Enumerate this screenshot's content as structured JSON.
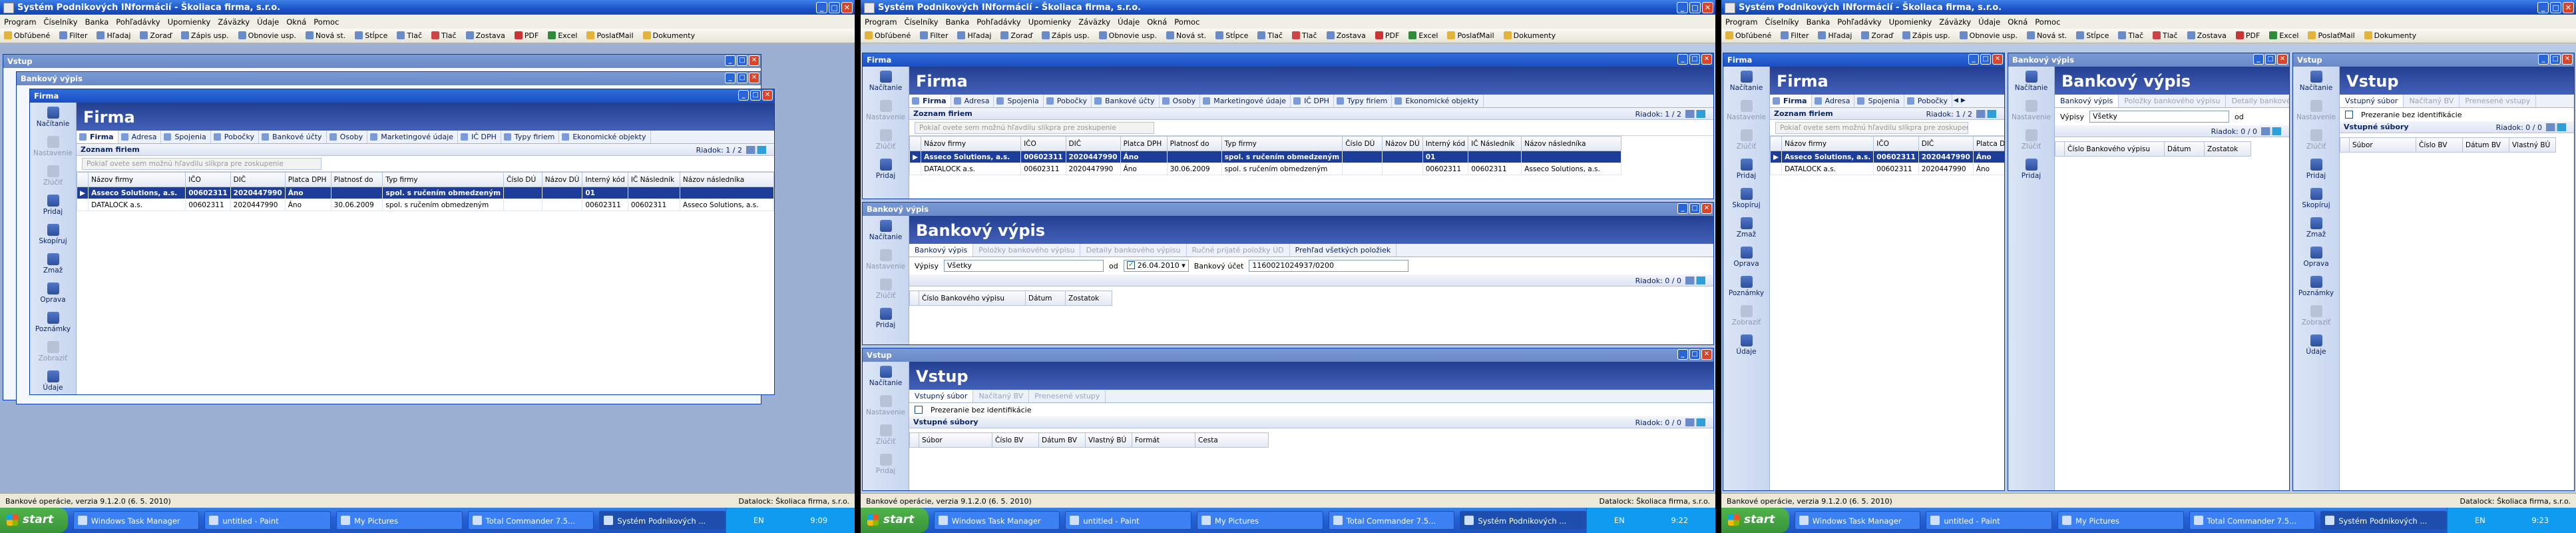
{
  "app": {
    "title": "Systém Podnikových INformácií - Školiaca firma, s.r.o.",
    "menu": [
      "Program",
      "Číselníky",
      "Banka",
      "Pohľadávky",
      "Upomienky",
      "Záväzky",
      "Údaje",
      "Okná",
      "Pomoc"
    ],
    "toolbar": [
      "Obľúbené",
      "Filter",
      "Hľadaj",
      "Zoraď",
      "Zápis usp.",
      "Obnovie usp.",
      "Nová st.",
      "Stĺpce",
      "Tlač",
      "Tlač",
      "Zostava",
      "PDF",
      "Excel",
      "PoslaťMail",
      "Dokumenty"
    ],
    "status_left": "Bankové operácie, verzia 9.1.2.0 (6. 5. 2010)",
    "status_right": "Datalock: Školiaca firma, s.r.o."
  },
  "taskbar": {
    "start": "start",
    "tasks": [
      "Windows Task Manager",
      "untitled - Paint",
      "My Pictures",
      "Total Commander 7.5...",
      "Systém Podnikových ..."
    ],
    "lang": "EN",
    "clock": [
      "9:09",
      "9:22",
      "9:23"
    ]
  },
  "firma": {
    "title": "Firma",
    "actions": [
      "Načítanie",
      "Nastavenie",
      "Zlúčiť",
      "Pridaj",
      "Skopíruj",
      "Zmaž",
      "Oprava",
      "Poznámky",
      "Zobraziť",
      "Údaje"
    ],
    "tabs": [
      "Firma",
      "Adresa",
      "Spojenia",
      "Pobočky",
      "Bankové účty",
      "Osoby",
      "Marketingové údaje",
      "IČ DPH",
      "Typy firiem",
      "Ekonomické objekty"
    ],
    "section": "Zoznam firiem",
    "records": "Riadok: 1 / 2",
    "filter_placeholder": "Pokiaľ ovete sem možnú hľavdilu slíkpra pre zoskupenie",
    "columns": [
      "Názov firmy",
      "IČO",
      "DIČ",
      "Platca DPH",
      "Platnosť do",
      "Typ firmy",
      "Číslo DÚ",
      "Názov DÚ",
      "Interný kód",
      "IČ Následník",
      "Názov následníka"
    ],
    "rows": [
      [
        "Asseco Solutions, a.s.",
        "00602311",
        "2020447990",
        "Áno",
        "",
        "spol. s ručením obmedzeným",
        "",
        "",
        "01",
        "",
        ""
      ],
      [
        "DATALOCK a.s.",
        "00602311",
        "2020447990",
        "Áno",
        "30.06.2009",
        "spol. s ručením obmedzeným",
        "",
        "",
        "00602311",
        "00602311",
        "Asseco Solutions, a.s."
      ]
    ]
  },
  "bank": {
    "title": "Bankový výpis",
    "actions": [
      "Načítanie",
      "Nastavenie",
      "Zlúčiť",
      "Pridaj"
    ],
    "tabs": [
      "Bankový výpis",
      "Položky bankového výpisu",
      "Detaily bankového výpisu",
      "Ručné prijaté položky ÚD",
      "Prehľad všetkých položiek"
    ],
    "vypisy_label": "Výpisy",
    "vypisy_value": "Všetky",
    "od_label": "od",
    "date": "26.04.2010",
    "account_label": "Bankový účet",
    "account": "1160021024937/0200",
    "records": "Riadok: 0 / 0",
    "columns": [
      "Číslo Bankového výpisu",
      "Dátum",
      "Zostatok"
    ]
  },
  "vstup": {
    "title": "Vstup",
    "actions": [
      "Načítanie",
      "Nastavenie",
      "Zlúčiť",
      "Pridaj",
      "Skopíruj",
      "Zmaž",
      "Oprava",
      "Poznámky",
      "Zobraziť",
      "Údaje"
    ],
    "tabs": [
      "Vstupný súbor",
      "Načítaný BV",
      "Prenesené vstupy"
    ],
    "checkbox": "Prezeranie bez identifikácie",
    "section": "Vstupné súbory",
    "records": "Riadok: 0 / 0",
    "columns": [
      "Súbor",
      "Číslo BV",
      "Dátum BV",
      "Vlastný BÚ",
      "Formát",
      "Cesta"
    ]
  },
  "colors": {
    "titlebar": "#1a54c8",
    "header": "#223f91",
    "selection": "#1c3d9a",
    "start": "#3a9438"
  }
}
